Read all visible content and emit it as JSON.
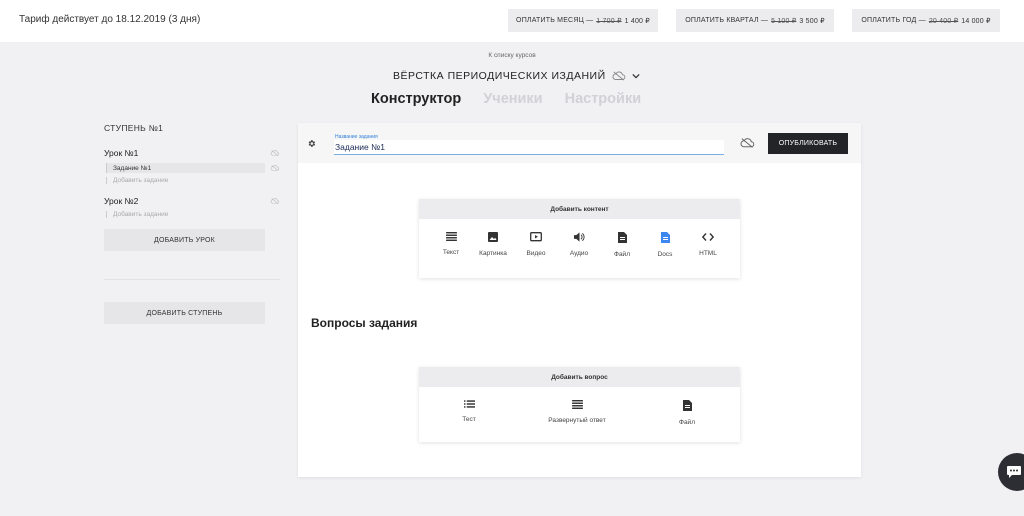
{
  "topbar": {
    "tariff_text": "Тариф действует до 18.12.2019 (3 дня)",
    "buttons": [
      {
        "label": "ОПЛАТИТЬ МЕСЯЦ —",
        "old_price": "1 700 ₽",
        "new_price": "1 400 ₽"
      },
      {
        "label": "ОПЛАТИТЬ КВАРТАЛ —",
        "old_price": "5 100 ₽",
        "new_price": "3 500 ₽"
      },
      {
        "label": "ОПЛАТИТЬ ГОД —",
        "old_price": "20 400 ₽",
        "new_price": "14 000 ₽"
      }
    ]
  },
  "header": {
    "back_link": "К списку курсов",
    "course_title": "ВЁРСТКА ПЕРИОДИЧЕСКИХ ИЗДАНИЙ",
    "tabs": [
      {
        "label": "Конструктор",
        "active": true
      },
      {
        "label": "Ученики",
        "active": false
      },
      {
        "label": "Настройки",
        "active": false
      }
    ]
  },
  "sidebar": {
    "stage_label": "СТУПЕНЬ №1",
    "lessons": [
      {
        "title": "Урок №1",
        "tasks": [
          "Задание №1"
        ],
        "add_task": "Добавить задание"
      },
      {
        "title": "Урок №2",
        "tasks": [],
        "add_task": "Добавить задание"
      }
    ],
    "add_lesson": "ДОБАВИТЬ УРОК",
    "add_stage": "ДОБАВИТЬ СТУПЕНЬ"
  },
  "editor": {
    "field_label": "Название задания",
    "field_value": "Задание №1",
    "publish": "ОПУБЛИКОВАТЬ",
    "add_content_title": "Добавить контент",
    "content_tools": [
      {
        "label": "Текст",
        "icon": "text-icon"
      },
      {
        "label": "Картинка",
        "icon": "image-icon"
      },
      {
        "label": "Видео",
        "icon": "video-icon"
      },
      {
        "label": "Аудио",
        "icon": "audio-icon"
      },
      {
        "label": "Файл",
        "icon": "file-icon"
      },
      {
        "label": "Docs",
        "icon": "docs-icon"
      },
      {
        "label": "HTML",
        "icon": "html-icon"
      }
    ],
    "questions_title": "Вопросы задания",
    "add_question_title": "Добавить вопрос",
    "question_tools": [
      {
        "label": "Тест",
        "icon": "list-icon"
      },
      {
        "label": "Развернутый ответ",
        "icon": "paragraph-icon"
      },
      {
        "label": "Файл",
        "icon": "file-icon"
      }
    ]
  },
  "colors": {
    "accent": "#2f7fd6",
    "dark_button": "#222428",
    "background": "#f1f1f3"
  }
}
